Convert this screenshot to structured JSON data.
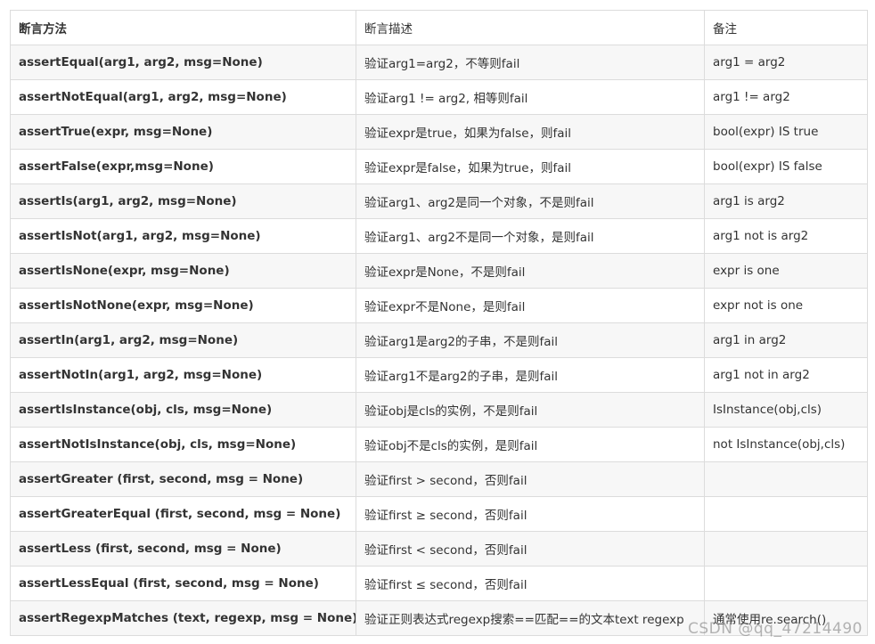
{
  "headers": [
    "断言方法",
    "断言描述",
    "备注"
  ],
  "rows": [
    {
      "method": "assertEqual(arg1, arg2, msg=None)",
      "desc": "验证arg1=arg2，不等则fail",
      "note": "arg1 = arg2"
    },
    {
      "method": "assertNotEqual(arg1, arg2, msg=None)",
      "desc": "验证arg1 != arg2, 相等则fail",
      "note": "arg1 != arg2"
    },
    {
      "method": "assertTrue(expr, msg=None)",
      "desc": "验证expr是true，如果为false，则fail",
      "note": "bool(expr) IS true"
    },
    {
      "method": "assertFalse(expr,msg=None)",
      "desc": "验证expr是false，如果为true，则fail",
      "note": "bool(expr) IS false"
    },
    {
      "method": "assertIs(arg1, arg2, msg=None)",
      "desc": "验证arg1、arg2是同一个对象，不是则fail",
      "note": "arg1 is arg2"
    },
    {
      "method": "assertIsNot(arg1, arg2, msg=None)",
      "desc": "验证arg1、arg2不是同一个对象，是则fail",
      "note": "arg1 not is arg2"
    },
    {
      "method": "assertIsNone(expr, msg=None)",
      "desc": "验证expr是None，不是则fail",
      "note": "expr is one"
    },
    {
      "method": "assertIsNotNone(expr, msg=None)",
      "desc": "验证expr不是None，是则fail",
      "note": "expr not is one"
    },
    {
      "method": "assertIn(arg1, arg2, msg=None)",
      "desc": "验证arg1是arg2的子串，不是则fail",
      "note": "arg1 in arg2"
    },
    {
      "method": "assertNotIn(arg1, arg2, msg=None)",
      "desc": "验证arg1不是arg2的子串，是则fail",
      "note": "arg1 not in arg2"
    },
    {
      "method": "assertIsInstance(obj, cls, msg=None)",
      "desc": "验证obj是cls的实例，不是则fail",
      "note": "IsInstance(obj,cls)"
    },
    {
      "method": "assertNotIsInstance(obj, cls, msg=None)",
      "desc": "验证obj不是cls的实例，是则fail",
      "note": "not IsInstance(obj,cls)"
    },
    {
      "method": "assertGreater (first, second, msg = None)",
      "desc": "验证first > second，否则fail",
      "note": ""
    },
    {
      "method": "assertGreaterEqual (first, second, msg = None)",
      "desc": "验证first ≥ second，否则fail",
      "note": ""
    },
    {
      "method": "assertLess (first, second, msg = None)",
      "desc": "验证first < second，否则fail",
      "note": ""
    },
    {
      "method": "assertLessEqual (first, second, msg = None)",
      "desc": "验证first ≤ second，否则fail",
      "note": ""
    },
    {
      "method": "assertRegexpMatches (text, regexp, msg = None)",
      "desc": "验证正则表达式regexp搜索==匹配==的文本text  regexp",
      "note": "通常使用re.search()"
    }
  ],
  "watermark": "CSDN @qq_47214490"
}
